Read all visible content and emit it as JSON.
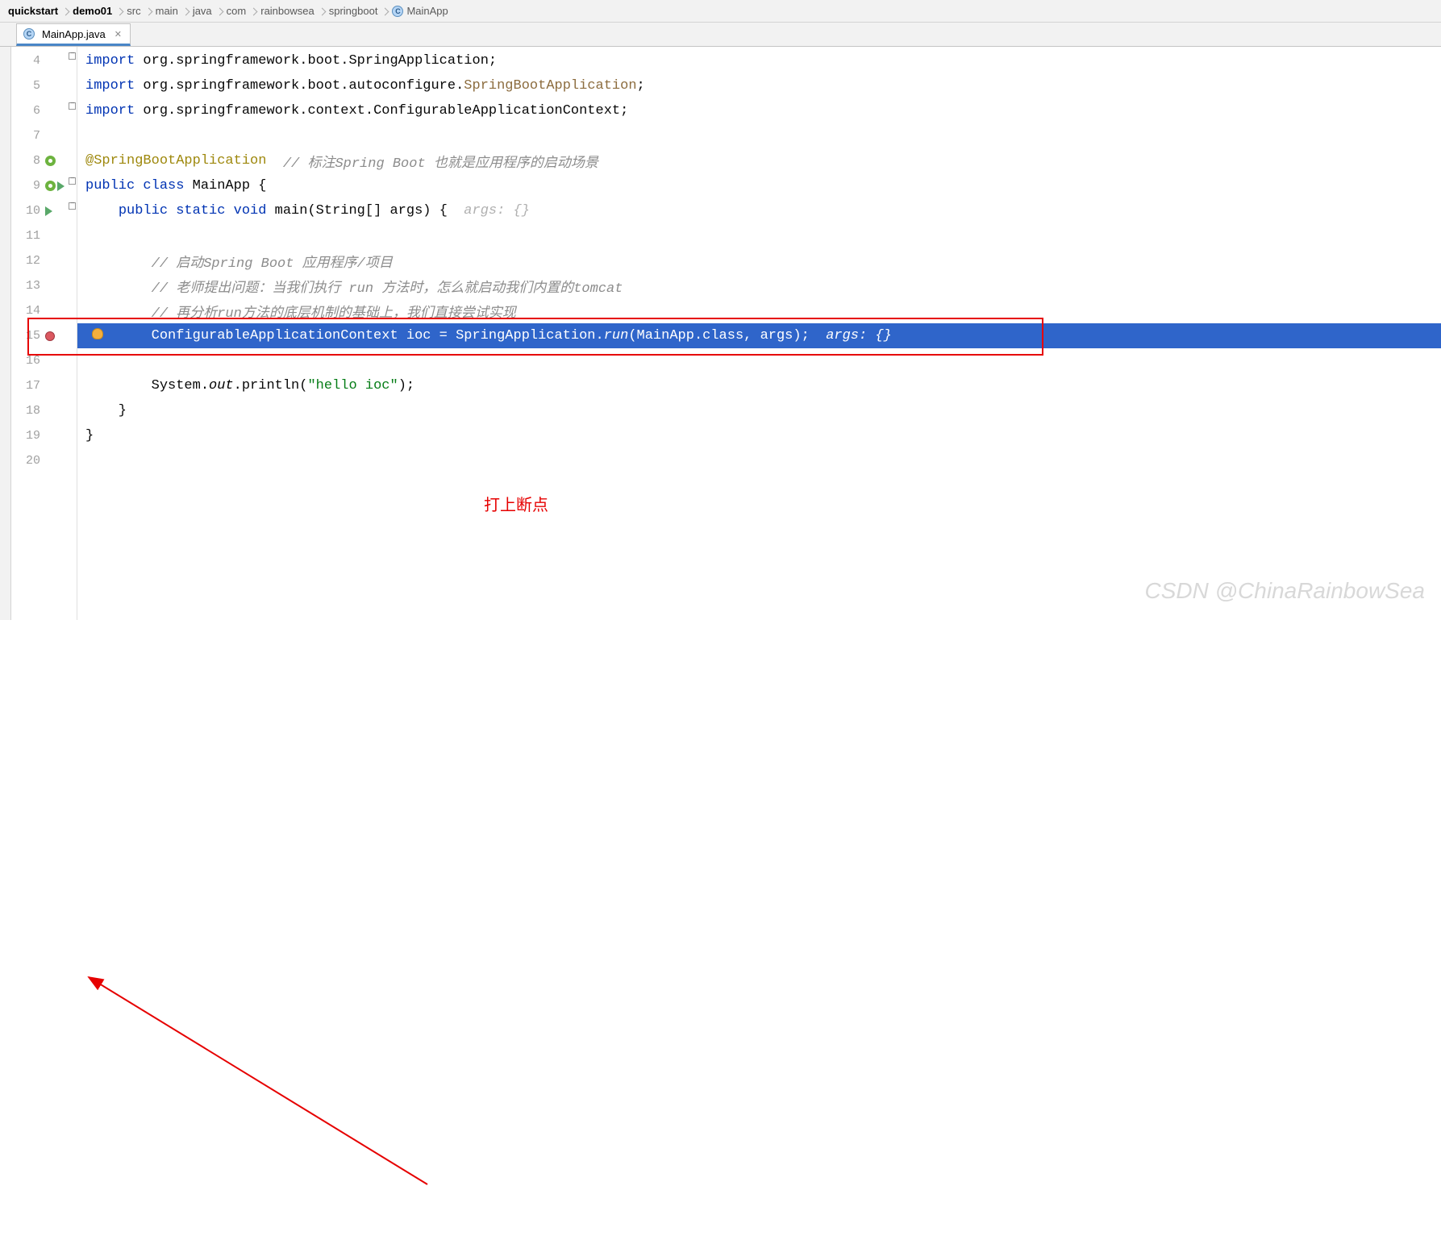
{
  "breadcrumb": [
    {
      "label": "quickstart",
      "bold": true
    },
    {
      "label": "demo01",
      "bold": true
    },
    {
      "label": "src",
      "bold": false
    },
    {
      "label": "main",
      "bold": false
    },
    {
      "label": "java",
      "bold": false
    },
    {
      "label": "com",
      "bold": false
    },
    {
      "label": "rainbowsea",
      "bold": false
    },
    {
      "label": "springboot",
      "bold": false
    },
    {
      "label": "MainApp",
      "bold": false,
      "icon": "class"
    }
  ],
  "tab": {
    "label": "MainApp.java",
    "icon": "class"
  },
  "gutter_start": 4,
  "code_lines": [
    {
      "n": 4,
      "segments": [
        {
          "t": "import ",
          "c": "kw"
        },
        {
          "t": "org.springframework.boot.SpringApplication;",
          "c": "plain"
        }
      ]
    },
    {
      "n": 5,
      "segments": [
        {
          "t": "import ",
          "c": "kw"
        },
        {
          "t": "org.springframework.boot.autoconfigure.",
          "c": "plain"
        },
        {
          "t": "SpringBootApplication",
          "c": "type-ref"
        },
        {
          "t": ";",
          "c": "plain"
        }
      ]
    },
    {
      "n": 6,
      "segments": [
        {
          "t": "import ",
          "c": "kw"
        },
        {
          "t": "org.springframework.context.ConfigurableApplicationContext;",
          "c": "plain"
        }
      ]
    },
    {
      "n": 7,
      "segments": []
    },
    {
      "n": 8,
      "icons": [
        "spring"
      ],
      "segments": [
        {
          "t": "@SpringBootApplication",
          "c": "anno"
        },
        {
          "t": "  // 标注Spring Boot 也就是应用程序的启动场景",
          "c": "comment"
        }
      ]
    },
    {
      "n": 9,
      "icons": [
        "spring",
        "run"
      ],
      "segments": [
        {
          "t": "public class ",
          "c": "kw"
        },
        {
          "t": "MainApp {",
          "c": "plain"
        }
      ]
    },
    {
      "n": 10,
      "icons": [
        "run"
      ],
      "segments": [
        {
          "t": "    ",
          "c": "plain"
        },
        {
          "t": "public static void ",
          "c": "kw"
        },
        {
          "t": "main(String[] args) {  ",
          "c": "plain"
        },
        {
          "t": "args: {}",
          "c": "comment-hint"
        }
      ]
    },
    {
      "n": 11,
      "segments": []
    },
    {
      "n": 12,
      "segments": [
        {
          "t": "        // 启动Spring Boot 应用程序/项目",
          "c": "comment"
        }
      ]
    },
    {
      "n": 13,
      "segments": [
        {
          "t": "        // 老师提出问题：当我们执行 run 方法时，怎么就启动我们内置的tomcat",
          "c": "comment"
        }
      ]
    },
    {
      "n": 14,
      "segments": [
        {
          "t": "        // 再分析run方法的底层机制的基础上，我们直接尝试实现",
          "c": "comment"
        }
      ]
    },
    {
      "n": 15,
      "hl": true,
      "bp": true,
      "bulb": true,
      "segments": [
        {
          "t": "        ConfigurableApplicationContext ioc = SpringApplication.",
          "c": "plain"
        },
        {
          "t": "run",
          "c": "it"
        },
        {
          "t": "(MainApp.",
          "c": "plain"
        },
        {
          "t": "class",
          "c": "kw"
        },
        {
          "t": ", args);  ",
          "c": "plain"
        },
        {
          "t": "args: {}",
          "c": "comment-hint"
        }
      ]
    },
    {
      "n": 16,
      "segments": []
    },
    {
      "n": 17,
      "segments": [
        {
          "t": "        System.",
          "c": "plain"
        },
        {
          "t": "out",
          "c": "it"
        },
        {
          "t": ".println(",
          "c": "plain"
        },
        {
          "t": "\"hello ioc\"",
          "c": "str"
        },
        {
          "t": ");",
          "c": "plain"
        }
      ]
    },
    {
      "n": 18,
      "segments": [
        {
          "t": "    }",
          "c": "plain"
        }
      ]
    },
    {
      "n": 19,
      "segments": [
        {
          "t": "}",
          "c": "plain"
        }
      ]
    },
    {
      "n": 20,
      "segments": []
    }
  ],
  "annotation": {
    "label": "打上断点"
  },
  "watermark": "CSDN @ChinaRainbowSea"
}
